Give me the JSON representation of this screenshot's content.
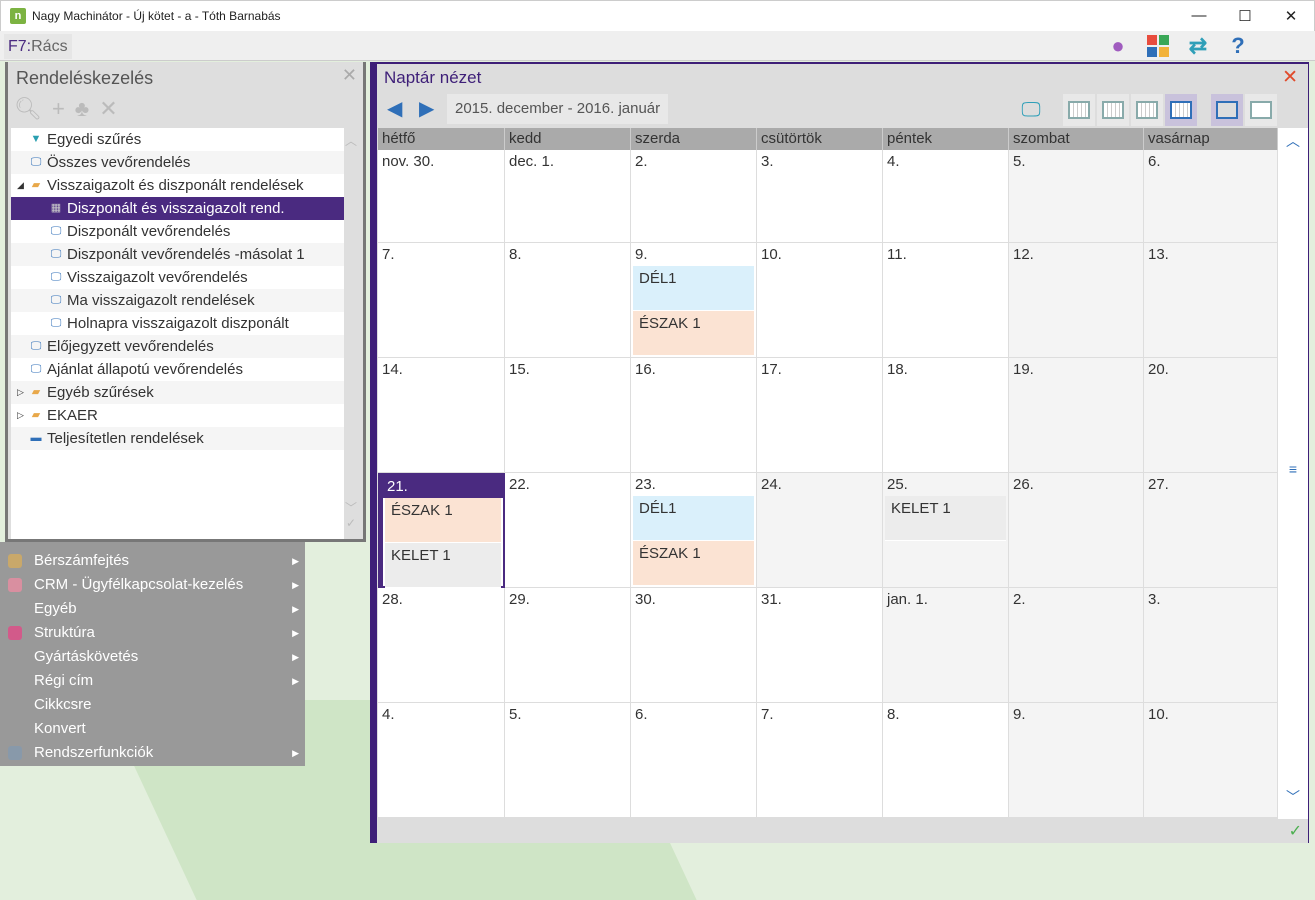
{
  "window": {
    "title": "Nagy Machinátor - Új kötet - a - Tóth Barnabás",
    "logo": "n",
    "minimize": "—",
    "maximize": "☐",
    "close": "✕"
  },
  "toolbar": {
    "shortcut_key": "F7:",
    "shortcut_label": "Rács",
    "icons": [
      "user-icon",
      "apps-icon",
      "swap-icon",
      "help-icon"
    ]
  },
  "left_panel": {
    "title": "Rendeléskezelés",
    "close": "✕",
    "tree": [
      {
        "label": "Egyedi szűrés",
        "icon": "filter",
        "level": 1
      },
      {
        "label": "Összes vevőrendelés",
        "icon": "monitor",
        "level": 1
      },
      {
        "label": "Visszaigazolt és diszponált rendelések",
        "icon": "folder",
        "level": 1,
        "toggle": "◢"
      },
      {
        "label": "Diszponált és visszaigazolt rend.",
        "icon": "grid",
        "level": 2,
        "selected": true
      },
      {
        "label": "Diszponált vevőrendelés",
        "icon": "monitor",
        "level": 2
      },
      {
        "label": "Diszponált vevőrendelés -másolat 1",
        "icon": "monitor",
        "level": 2
      },
      {
        "label": "Visszaigazolt vevőrendelés",
        "icon": "monitor",
        "level": 2
      },
      {
        "label": "Ma visszaigazolt rendelések",
        "icon": "monitor",
        "level": 2
      },
      {
        "label": "Holnapra visszaigazolt diszponált",
        "icon": "monitor",
        "level": 2
      },
      {
        "label": "Előjegyzett vevőrendelés",
        "icon": "monitor",
        "level": 1
      },
      {
        "label": "Ajánlat állapotú vevőrendelés",
        "icon": "monitor",
        "level": 1
      },
      {
        "label": "Egyéb szűrések",
        "icon": "folder",
        "level": 1,
        "toggle": "▷"
      },
      {
        "label": "EKAER",
        "icon": "folder",
        "level": 1,
        "toggle": "▷"
      },
      {
        "label": "Teljesítetlen rendelések",
        "icon": "printer",
        "level": 1
      }
    ]
  },
  "menu": [
    {
      "label": "Bérszámfejtés",
      "submenu": true,
      "icon": "#c9a86a"
    },
    {
      "label": "CRM - Ügyfélkapcsolat-kezelés",
      "submenu": true,
      "icon": "#d98fa0"
    },
    {
      "label": "Egyéb",
      "submenu": true
    },
    {
      "label": "Struktúra",
      "submenu": true,
      "icon": "#d25a8a"
    },
    {
      "label": "Gyártáskövetés",
      "submenu": true
    },
    {
      "label": "Régi cím",
      "submenu": true
    },
    {
      "label": "Cikkcsre"
    },
    {
      "label": "Konvert"
    },
    {
      "label": "Rendszerfunkciók",
      "submenu": true,
      "icon": "#8899aa"
    }
  ],
  "calendar": {
    "title": "Naptár nézet",
    "range": "2015. december - 2016. január",
    "weekdays": [
      "hétfő",
      "kedd",
      "szerda",
      "csütörtök",
      "péntek",
      "szombat",
      "vasárnap"
    ],
    "weeks": [
      [
        {
          "d": "nov. 30."
        },
        {
          "d": "dec. 1."
        },
        {
          "d": "2."
        },
        {
          "d": "3."
        },
        {
          "d": "4."
        },
        {
          "d": "5.",
          "g": 1
        },
        {
          "d": "6.",
          "g": 1
        }
      ],
      [
        {
          "d": "7."
        },
        {
          "d": "8."
        },
        {
          "d": "9.",
          "ev": [
            {
              "t": "DÉL1",
              "c": "#daf0fb"
            },
            {
              "t": "ÉSZAK 1",
              "c": "#fbe3d3"
            }
          ]
        },
        {
          "d": "10."
        },
        {
          "d": "11."
        },
        {
          "d": "12.",
          "g": 1
        },
        {
          "d": "13.",
          "g": 1
        }
      ],
      [
        {
          "d": "14."
        },
        {
          "d": "15."
        },
        {
          "d": "16."
        },
        {
          "d": "17."
        },
        {
          "d": "18."
        },
        {
          "d": "19.",
          "g": 1
        },
        {
          "d": "20.",
          "g": 1
        }
      ],
      [
        {
          "d": "21.",
          "today": 1,
          "ev": [
            {
              "t": "ÉSZAK 1",
              "c": "#fbe3d3"
            },
            {
              "t": "KELET 1",
              "c": "#ececec"
            }
          ]
        },
        {
          "d": "22."
        },
        {
          "d": "23.",
          "ev": [
            {
              "t": "DÉL1",
              "c": "#daf0fb"
            },
            {
              "t": "ÉSZAK 1",
              "c": "#fbe3d3"
            }
          ]
        },
        {
          "d": "24.",
          "g": 1
        },
        {
          "d": "25.",
          "g": 1,
          "ev": [
            {
              "t": "KELET 1",
              "c": "#ececec"
            }
          ]
        },
        {
          "d": "26.",
          "g": 1
        },
        {
          "d": "27.",
          "g": 1
        }
      ],
      [
        {
          "d": "28."
        },
        {
          "d": "29."
        },
        {
          "d": "30."
        },
        {
          "d": "31."
        },
        {
          "d": "jan. 1.",
          "g": 1
        },
        {
          "d": "2.",
          "g": 1
        },
        {
          "d": "3.",
          "g": 1
        }
      ],
      [
        {
          "d": "4."
        },
        {
          "d": "5."
        },
        {
          "d": "6."
        },
        {
          "d": "7."
        },
        {
          "d": "8."
        },
        {
          "d": "9.",
          "g": 1
        },
        {
          "d": "10.",
          "g": 1
        }
      ]
    ]
  }
}
